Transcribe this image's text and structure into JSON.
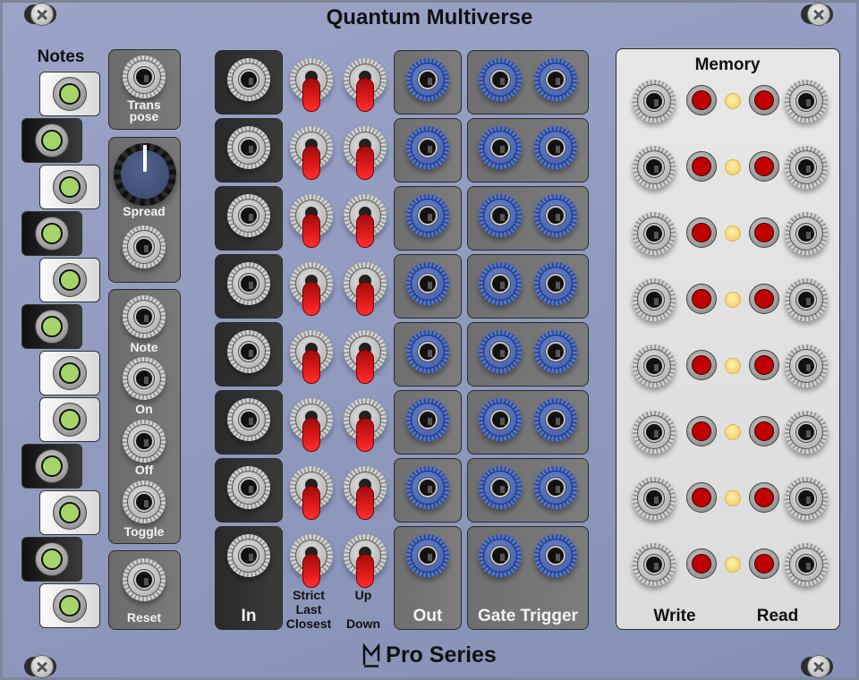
{
  "module": {
    "title": "Quantum Multiverse",
    "brand": "Pro Series",
    "brand_logo_icon": "ml-logo-icon",
    "colors": {
      "panel_bg": "#959ec3",
      "section_grey": "#747474",
      "section_dark": "#333333",
      "memory_bg": "#e2e2e2",
      "led_green": "#a6d46a",
      "toggle_red": "#e11a1a",
      "button_red": "#c00000",
      "led_yellow": "#f7d874",
      "jack_blue": "#3a56a8",
      "knob_blue": "#46557d"
    }
  },
  "notes": {
    "label": "Notes",
    "keys": [
      {
        "color": "white",
        "lit": true
      },
      {
        "color": "black",
        "lit": true
      },
      {
        "color": "white",
        "lit": true
      },
      {
        "color": "black",
        "lit": true
      },
      {
        "color": "white",
        "lit": true
      },
      {
        "color": "black",
        "lit": true
      },
      {
        "color": "white",
        "lit": true
      },
      {
        "color": "white",
        "lit": true
      },
      {
        "color": "black",
        "lit": true
      },
      {
        "color": "white",
        "lit": true
      },
      {
        "color": "black",
        "lit": true
      },
      {
        "color": "white",
        "lit": true
      }
    ]
  },
  "controls": {
    "transpose_label_line1": "Trans",
    "transpose_label_line2": "pose",
    "spread_label": "Spread",
    "note_label": "Note",
    "on_label": "On",
    "off_label": "Off",
    "toggle_label": "Toggle",
    "reset_label": "Reset"
  },
  "channels": {
    "count": 8,
    "in_label": "In",
    "mode_label_line1": "Strict",
    "mode_label_line2": "Last",
    "mode_label_line3": "Closest",
    "dir_label_line1": "Up",
    "dir_label_line2": "Down",
    "out_label": "Out",
    "gate_trigger_label": "Gate Trigger",
    "mode_switch_positions": [
      "down",
      "down",
      "down",
      "down",
      "down",
      "down",
      "down",
      "down"
    ],
    "dir_switch_positions": [
      "down",
      "down",
      "down",
      "down",
      "down",
      "down",
      "down",
      "down"
    ]
  },
  "memory": {
    "label": "Memory",
    "write_label": "Write",
    "read_label": "Read",
    "slots": 8
  }
}
